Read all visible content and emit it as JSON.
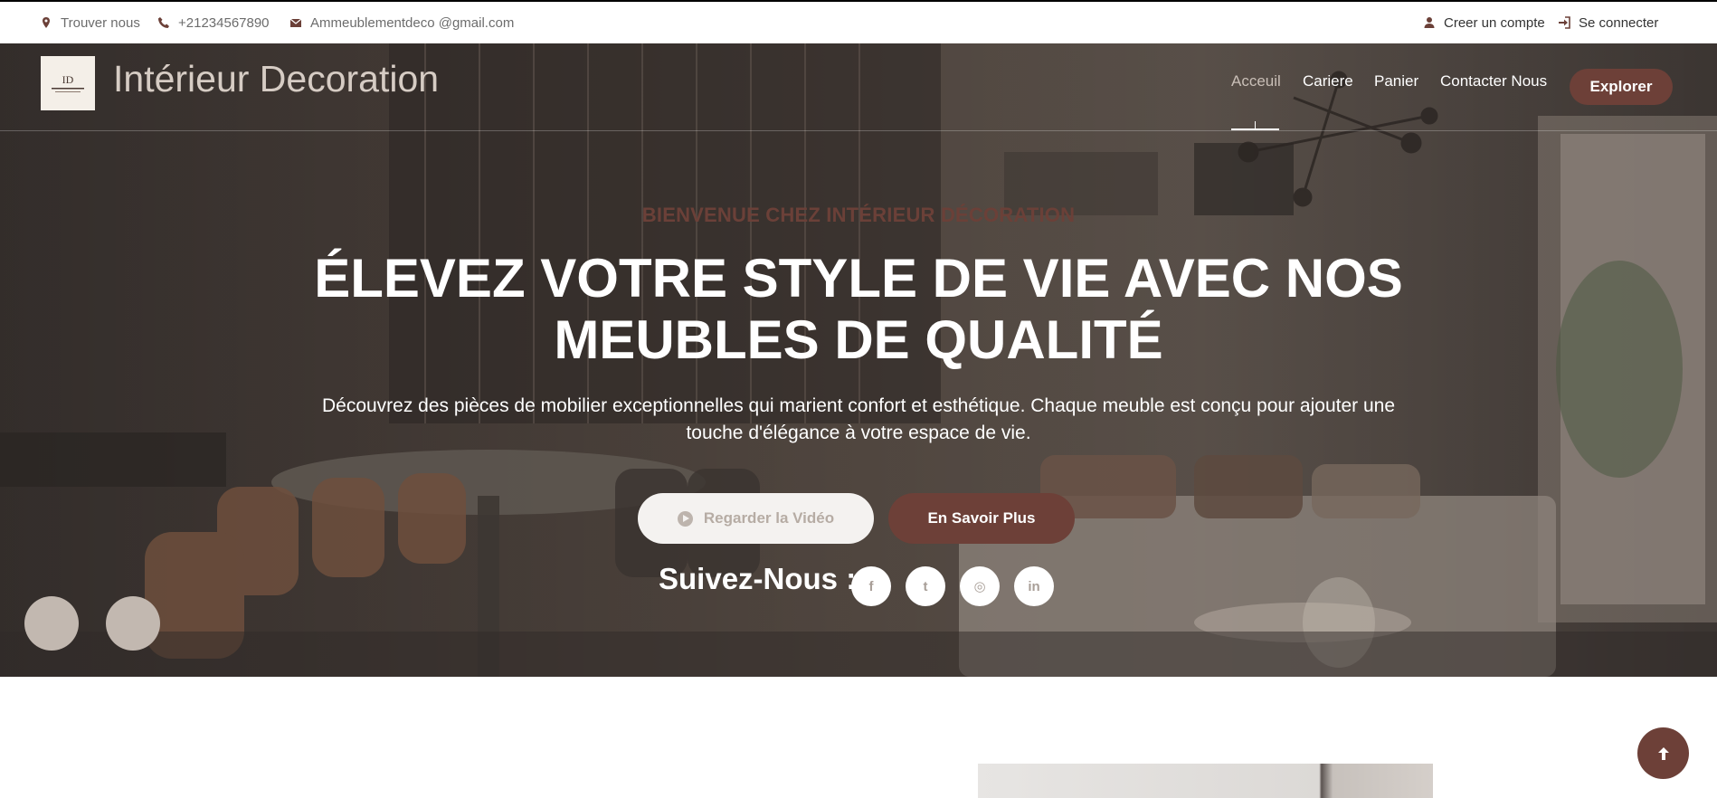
{
  "topbar": {
    "find_us": "Trouver nous",
    "phone": "+21234567890",
    "email": "Ammeublementdeco @gmail.com",
    "create_account": "Creer un compte",
    "login": "Se connecter",
    "icons": [
      "location-icon",
      "phone-icon",
      "mail-icon",
      "user-icon",
      "login-icon"
    ]
  },
  "header": {
    "brand": "Intérieur Decoration",
    "nav": [
      "Acceuil",
      "Cariere",
      "Panier",
      "Contacter Nous"
    ],
    "active_nav": "Acceuil",
    "cta": "Explorer"
  },
  "hero": {
    "welcome": "BIENVENUE CHEZ INTÉRIEUR DÉCORATION",
    "headline_line1": "ÉLEVEZ VOTRE STYLE DE VIE AVEC NOS",
    "headline_line2": "MEUBLES DE QUALITÉ",
    "subtitle_line1": "Découvrez des pièces de mobilier exceptionnelles qui marient confort et esthétique. Chaque meuble est conçu pour ajouter une",
    "subtitle_line2": "touche d'élégance à votre espace de vie.",
    "video_button": "Regarder la Vidéo",
    "more_button": "En Savoir Plus",
    "follow_label": "Suivez-Nous :",
    "social": [
      {
        "name": "facebook-icon",
        "glyph": "f"
      },
      {
        "name": "twitter-icon",
        "glyph": "t"
      },
      {
        "name": "instagram-icon",
        "glyph": "◎"
      },
      {
        "name": "linkedin-icon",
        "glyph": "in"
      }
    ]
  },
  "colors": {
    "accent": "#6d4038",
    "hero_overlay": "#2d2826",
    "logo_text": "#d6ccc4"
  }
}
